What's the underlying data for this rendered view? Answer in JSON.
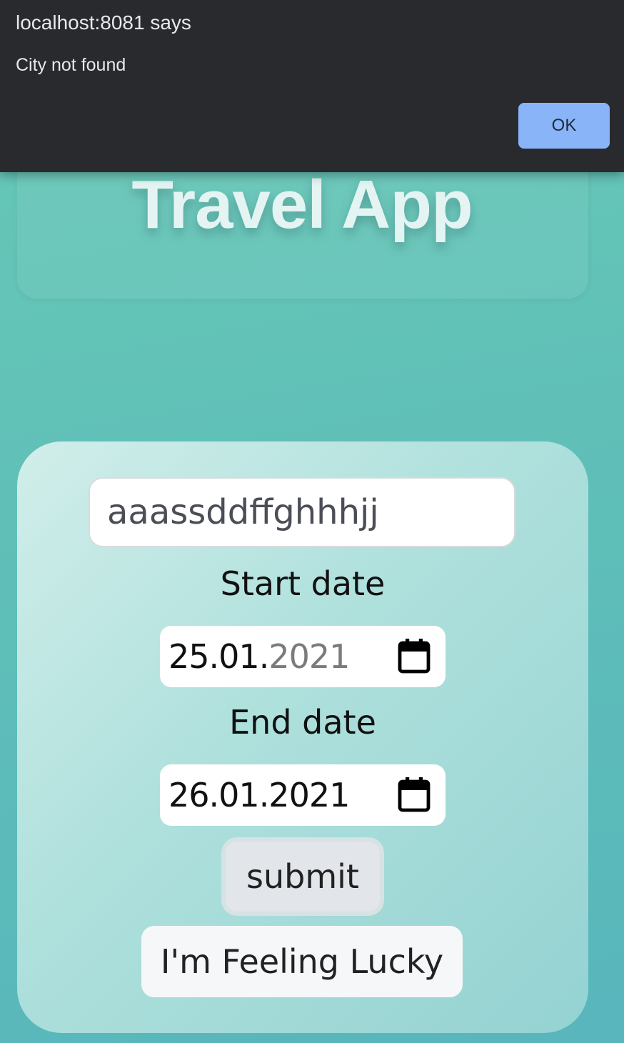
{
  "alert": {
    "origin": "localhost:8081 says",
    "message": "City not found",
    "ok_label": "OK"
  },
  "header": {
    "title": "Travel App"
  },
  "form": {
    "city_value": "aaassddffghhhjj",
    "start_label": "Start date",
    "start_date": {
      "day_month": "25.01.",
      "year": "2021"
    },
    "end_label": "End date",
    "end_date": "26.01.2021",
    "submit_label": "submit",
    "lucky_label": "I'm Feeling Lucky",
    "calendar_icon": "calendar-icon"
  },
  "colors": {
    "background": "#5fbfb8",
    "alert_background": "#292a2e",
    "ok_button": "#8ab4f8",
    "title": "#e3f4f2"
  }
}
